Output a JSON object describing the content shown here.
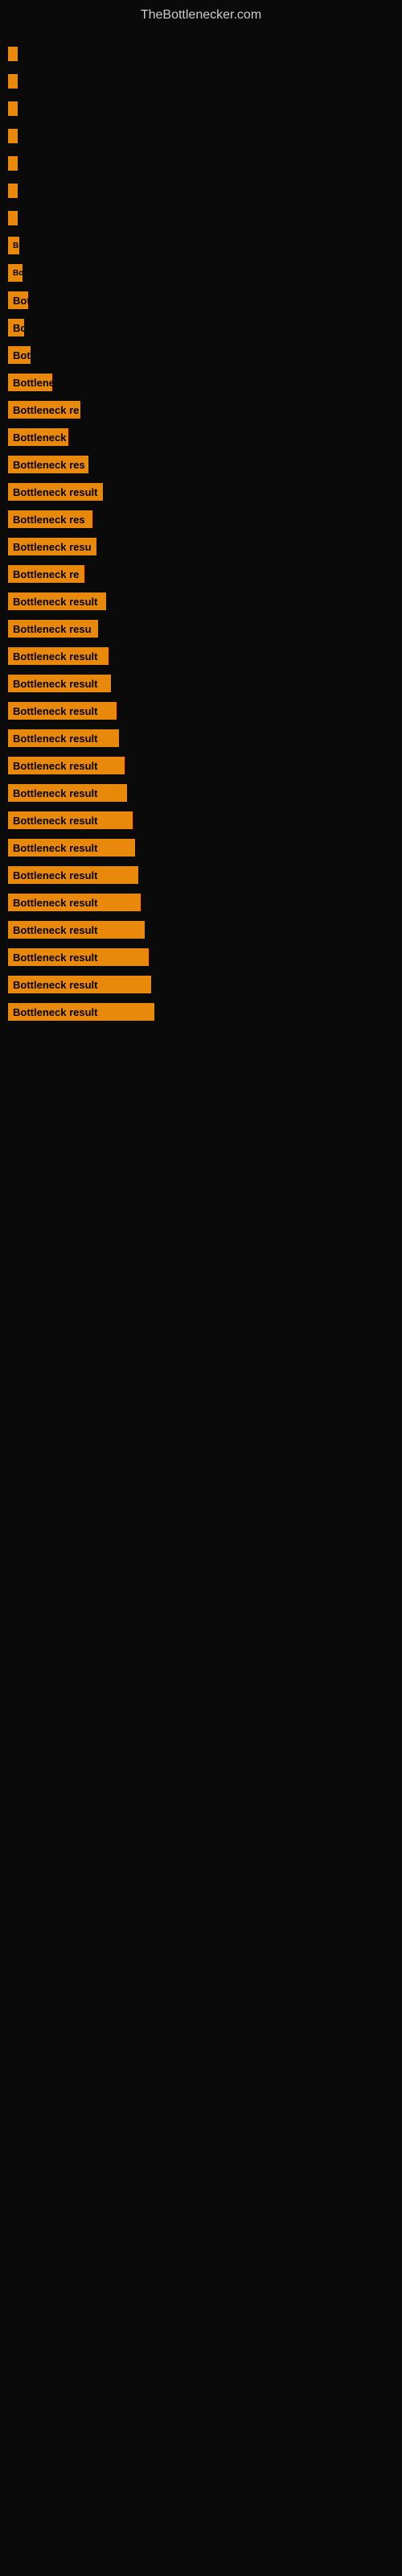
{
  "site": {
    "title": "TheBottlenecker.com"
  },
  "bars": [
    {
      "label": "",
      "width": 2
    },
    {
      "label": "",
      "width": 3
    },
    {
      "label": "",
      "width": 3
    },
    {
      "label": "",
      "width": 4
    },
    {
      "label": "",
      "width": 4
    },
    {
      "label": "",
      "width": 4
    },
    {
      "label": "",
      "width": 5
    },
    {
      "label": "B",
      "width": 14
    },
    {
      "label": "Bo",
      "width": 18
    },
    {
      "label": "Bott",
      "width": 25
    },
    {
      "label": "Bo",
      "width": 20
    },
    {
      "label": "Bott",
      "width": 28
    },
    {
      "label": "Bottlene",
      "width": 55
    },
    {
      "label": "Bottleneck re",
      "width": 90
    },
    {
      "label": "Bottleneck",
      "width": 75
    },
    {
      "label": "Bottleneck res",
      "width": 100
    },
    {
      "label": "Bottleneck result",
      "width": 118
    },
    {
      "label": "Bottleneck res",
      "width": 105
    },
    {
      "label": "Bottleneck resu",
      "width": 110
    },
    {
      "label": "Bottleneck re",
      "width": 95
    },
    {
      "label": "Bottleneck result",
      "width": 122
    },
    {
      "label": "Bottleneck resu",
      "width": 112
    },
    {
      "label": "Bottleneck result",
      "width": 125
    },
    {
      "label": "Bottleneck result",
      "width": 128
    },
    {
      "label": "Bottleneck result",
      "width": 135
    },
    {
      "label": "Bottleneck result",
      "width": 138
    },
    {
      "label": "Bottleneck result",
      "width": 145
    },
    {
      "label": "Bottleneck result",
      "width": 148
    },
    {
      "label": "Bottleneck result",
      "width": 155
    },
    {
      "label": "Bottleneck result",
      "width": 158
    },
    {
      "label": "Bottleneck result",
      "width": 162
    },
    {
      "label": "Bottleneck result",
      "width": 165
    },
    {
      "label": "Bottleneck result",
      "width": 170
    },
    {
      "label": "Bottleneck result",
      "width": 175
    },
    {
      "label": "Bottleneck result",
      "width": 178
    },
    {
      "label": "Bottleneck result",
      "width": 182
    }
  ]
}
